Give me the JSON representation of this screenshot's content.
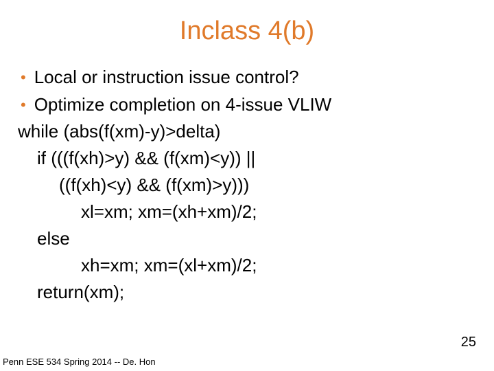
{
  "title": "Inclass 4(b)",
  "bullets": [
    "Local or instruction issue control?",
    "Optimize completion on 4-issue VLIW"
  ],
  "code": {
    "l0": "while (abs(f(xm)-y)>delta)",
    "l1": "if (((f(xh)>y) && (f(xm)<y)) ||",
    "l2": "((f(xh)<y) && (f(xm)>y)))",
    "l3": "xl=xm; xm=(xh+xm)/2;",
    "l4": "else",
    "l5": "xh=xm; xm=(xl+xm)/2;",
    "l6": "return(xm);"
  },
  "footer": "Penn ESE 534 Spring 2014 -- De. Hon",
  "page": "25"
}
